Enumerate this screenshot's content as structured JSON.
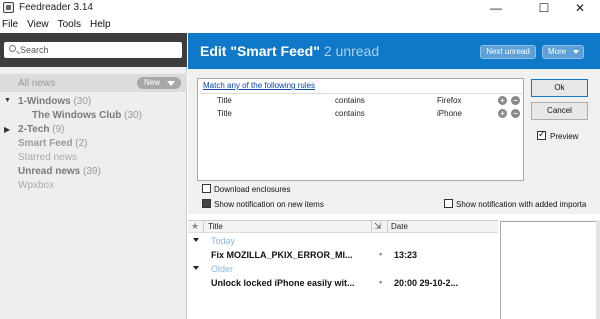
{
  "window": {
    "title": "Feedreader 3.14",
    "minimize": "—",
    "maximize": "☐",
    "close": "✕"
  },
  "menu": [
    "File",
    "View",
    "Tools",
    "Help"
  ],
  "sidebar": {
    "search_placeholder": "Search",
    "all_news": "All news",
    "new_button": "New",
    "items": [
      {
        "label": "1-Windows",
        "count": "(30)"
      },
      {
        "label": "The Windows Club",
        "count": "(30)"
      },
      {
        "label": "2-Tech",
        "count": "(9)"
      },
      {
        "label": "Smart Feed",
        "count": "(2)"
      },
      {
        "label": "Starred news",
        "count": ""
      },
      {
        "label": "Unread news",
        "count": "(39)"
      },
      {
        "label": "Wpxbox",
        "count": ""
      }
    ]
  },
  "header": {
    "title": "Edit \"Smart Feed\"",
    "unread": "2 unread",
    "next_unread": "Next unread",
    "more": "More"
  },
  "rules": {
    "match_link": "Match any of the following rules",
    "rows": [
      {
        "field": "Title",
        "operator": "contains",
        "value": "Firefox"
      },
      {
        "field": "Title",
        "operator": "contains",
        "value": "iPhone"
      }
    ],
    "add": "+",
    "remove": "−"
  },
  "dialog": {
    "ok": "Ok",
    "cancel": "Cancel",
    "preview": "Preview",
    "download_enclosures": "Download enclosures",
    "show_notification": "Show notification on new items",
    "show_notification_added": "Show notification with added importa"
  },
  "list": {
    "col_title": "Title",
    "col_date": "Date",
    "groups": [
      {
        "label": "Today",
        "articles": [
          {
            "title": "Fix MOZILLA_PKIX_ERROR_MI...",
            "dot": "•",
            "date": "13:23"
          }
        ]
      },
      {
        "label": "Older",
        "articles": [
          {
            "title": "Unlock locked iPhone easily wit...",
            "dot": "•",
            "date": "20:00 29-10-2..."
          }
        ]
      }
    ]
  }
}
